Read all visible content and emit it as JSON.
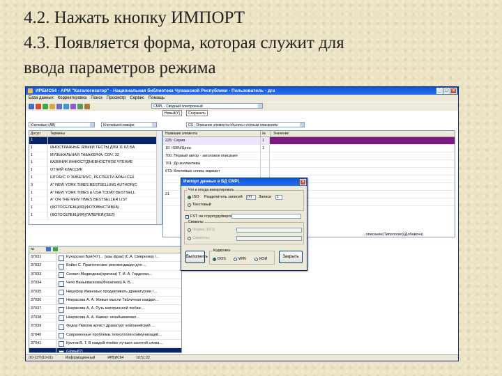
{
  "slide": {
    "lines": [
      "4.2. Нажать кнопку ИМПОРТ",
      "4.3. Появляется форма, которая служит для",
      "ввода параметров режима"
    ]
  },
  "window": {
    "title": "ИРБИС64 - АРМ \"Каталогизатор\" - Национальная библиотека Чувашской Республики - Пользователь - дга",
    "menu": [
      "База данных",
      "Корректировка",
      "Поиск",
      "Просмотр",
      "Сервис",
      "Помощь"
    ],
    "toolbar": {
      "combo_main": "CMPL - Сводный электронный",
      "tab1": "Новый(Y)",
      "tab2": "Сохранить",
      "combo_left1": "Ключевые (АВ)",
      "combo_left2": "Ключевые/словари",
      "combo_right": "CS - Описание элемента объекта с полным описанием",
      "btn_right": "Просмотр"
    },
    "left_panel": {
      "headers": [
        "Досуп",
        "Термины"
      ],
      "rows": [
        {
          "n": "1",
          "t": ""
        },
        {
          "n": "1",
          "t": "ИНОСТРАННЫЕ ЯЗЫКИ ТЕСТЫ ДЛЯ 11 КЛ БА"
        },
        {
          "n": "1",
          "t": "МУЗЫКАЛЬНАЯ ТАБАКЕРКА: СОЧ. 32"
        },
        {
          "n": "1",
          "t": "КАЗИНИК ИНФОСТ(ДНЕВНОСТНОЕ ЧТЕНИЕ"
        },
        {
          "n": "1",
          "t": "ОТЧИЙ КЛАССИК"
        },
        {
          "n": "1",
          "t": "ШТРАУС Р. ЗИБЕЛИУС, РЕСПЕКТИ АРАН СЕК"
        },
        {
          "n": "3",
          "t": "А\" NEW YORK TIMES BESTSELLING AUTHOR(С"
        },
        {
          "n": "1",
          "t": "А\" NEW YORK TIMES & USA TODAY BESTSELL"
        },
        {
          "n": "1",
          "t": "А\" ON THE NEW TIMES BESTSELLER LIST"
        },
        {
          "n": "1",
          "t": "(ФОТОСЕЛЕКЦИЯ)(ФОТОВЫСТАВКА)"
        },
        {
          "n": "1",
          "t": "(ФОТОСЕЛЕКЦИЯ)(ГАЛЕРЕЯ)(ЗЕЛ)"
        }
      ]
    },
    "right_panel": {
      "headers": [
        "Название элемента",
        "№",
        "Значение"
      ],
      "rows": [
        {
          "name": "225: Серия",
          "num": "1",
          "val": "",
          "sel": true
        },
        {
          "name": "10: ISBN/Цена",
          "num": "1",
          "val": "",
          "sel": false
        },
        {
          "name": "700: Первый автор - заголовок описания",
          "num": "",
          "val": "",
          "sel": false
        },
        {
          "name": "701: Др.коллективы",
          "num": "",
          "val": "",
          "sel": false
        },
        {
          "name": "673: Ключевые слова, вариант",
          "num": "",
          "val": "",
          "sel": false
        },
        {
          "name": "",
          "num": "",
          "val": "",
          "sel": false
        },
        {
          "name": "",
          "num": "",
          "val": "",
          "sel": false
        },
        {
          "name": "21",
          "num": "",
          "val": "",
          "sel": false
        },
        {
          "name": "",
          "num": "",
          "val": "",
          "sel": false
        }
      ],
      "tail_text": "...описание(Типология)(Добавочн)"
    },
    "bottom_list": {
      "rows": [
        {
          "id": "37031",
          "t": "Кухарская Бри(ЧУ)… [азы фрак] (С.А. Смирнова) /…"
        },
        {
          "id": "37032",
          "t": "Бойко С. Практические рекомендации для …"
        },
        {
          "id": "37033",
          "t": "Сеевич Медведева(оригина) Т. И. А. Гордеева…"
        },
        {
          "id": "37034",
          "t": "Чечо Ваньёвалнова(Фонапева) А. В…"
        },
        {
          "id": "37035",
          "t": "Ницефор Ивановых продавливать драматургии /…"
        },
        {
          "id": "37036",
          "t": "Некрасова А. А. Живые мысли Табличная каждая…"
        },
        {
          "id": "37037",
          "t": "Некрасова А. А. Путь материнской любви…"
        },
        {
          "id": "37038",
          "t": "Некрасова А. А. Кавказ: незабываемая…"
        },
        {
          "id": "37039",
          "t": "Федор Павлов артист драматург компанейский …"
        },
        {
          "id": "37040",
          "t": "Современные проблемы технологии коммуникаций…"
        },
        {
          "id": "37041",
          "t": "Кротов В. Т. В каждой ячейке лучших занятий слова…"
        },
        {
          "id": "",
          "t": "(Новый?)"
        }
      ]
    },
    "status": [
      "(IO-13?)(10-01)",
      "Информационный",
      "ИРБИС64",
      "10:51:22"
    ]
  },
  "dialog": {
    "title": "Импорт данных в БД CMPL",
    "group1_label": "Что и откуда импортировать",
    "radio_iso": "ISO",
    "radio_delim_label": "Разделитель записей",
    "field_delim": "(#)",
    "field_count_label": "Записи",
    "field_count": "1",
    "radio_text": "Текстовый",
    "check_fst": "FST на структуру/версию",
    "check_group_label": "Символы",
    "radio_dis1": "Форма (ISO)",
    "radio_dis2": "Символы",
    "group2_label": "Кодировка",
    "radio_dos": "DOS",
    "radio_win": "WIN",
    "radio_koi": "КОИ",
    "btn_import": "Выполнить",
    "btn_cancel": "Закрыть"
  }
}
